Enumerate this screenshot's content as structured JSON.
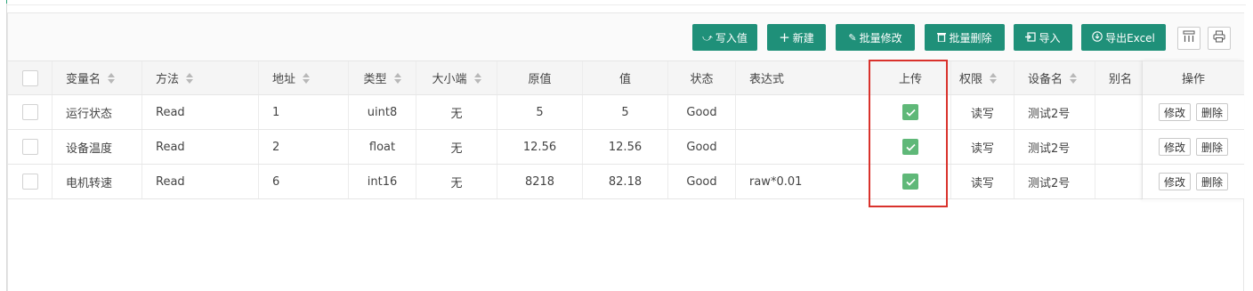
{
  "toolbar": {
    "write_value": "写入值",
    "create": "新建",
    "batch_edit": "批量修改",
    "batch_delete": "批量删除",
    "import": "导入",
    "export_excel": "导出Excel"
  },
  "table": {
    "headers": {
      "name": "变量名",
      "method": "方法",
      "address": "地址",
      "type": "类型",
      "endian": "大小端",
      "raw": "原值",
      "value": "值",
      "status": "状态",
      "expression": "表达式",
      "upload": "上传",
      "permission": "权限",
      "device": "设备名",
      "alias": "别名",
      "actions": "操作"
    },
    "rows": [
      {
        "name": "运行状态",
        "method": "Read",
        "address": "1",
        "type": "uint8",
        "endian": "无",
        "raw": "5",
        "value": "5",
        "status": "Good",
        "expression": "",
        "upload": true,
        "permission": "读写",
        "device": "测试2号",
        "alias": "",
        "edit": "修改",
        "delete": "删除"
      },
      {
        "name": "设备温度",
        "method": "Read",
        "address": "2",
        "type": "float",
        "endian": "无",
        "raw": "12.56",
        "value": "12.56",
        "status": "Good",
        "expression": "",
        "upload": true,
        "permission": "读写",
        "device": "测试2号",
        "alias": "",
        "edit": "修改",
        "delete": "删除"
      },
      {
        "name": "电机转速",
        "method": "Read",
        "address": "6",
        "type": "int16",
        "endian": "无",
        "raw": "8218",
        "value": "82.18",
        "status": "Good",
        "expression": "raw*0.01",
        "upload": true,
        "permission": "读写",
        "device": "测试2号",
        "alias": "",
        "edit": "修改",
        "delete": "删除"
      }
    ]
  },
  "colors": {
    "primary": "#1f9079",
    "checkbox_on": "#5fb878",
    "highlight": "#d9322c"
  },
  "icons": [
    "write-arrow-icon",
    "plus-icon",
    "pencil-icon",
    "trash-icon",
    "import-icon",
    "download-icon",
    "columns-icon",
    "print-icon",
    "check-icon",
    "sort-icon"
  ]
}
